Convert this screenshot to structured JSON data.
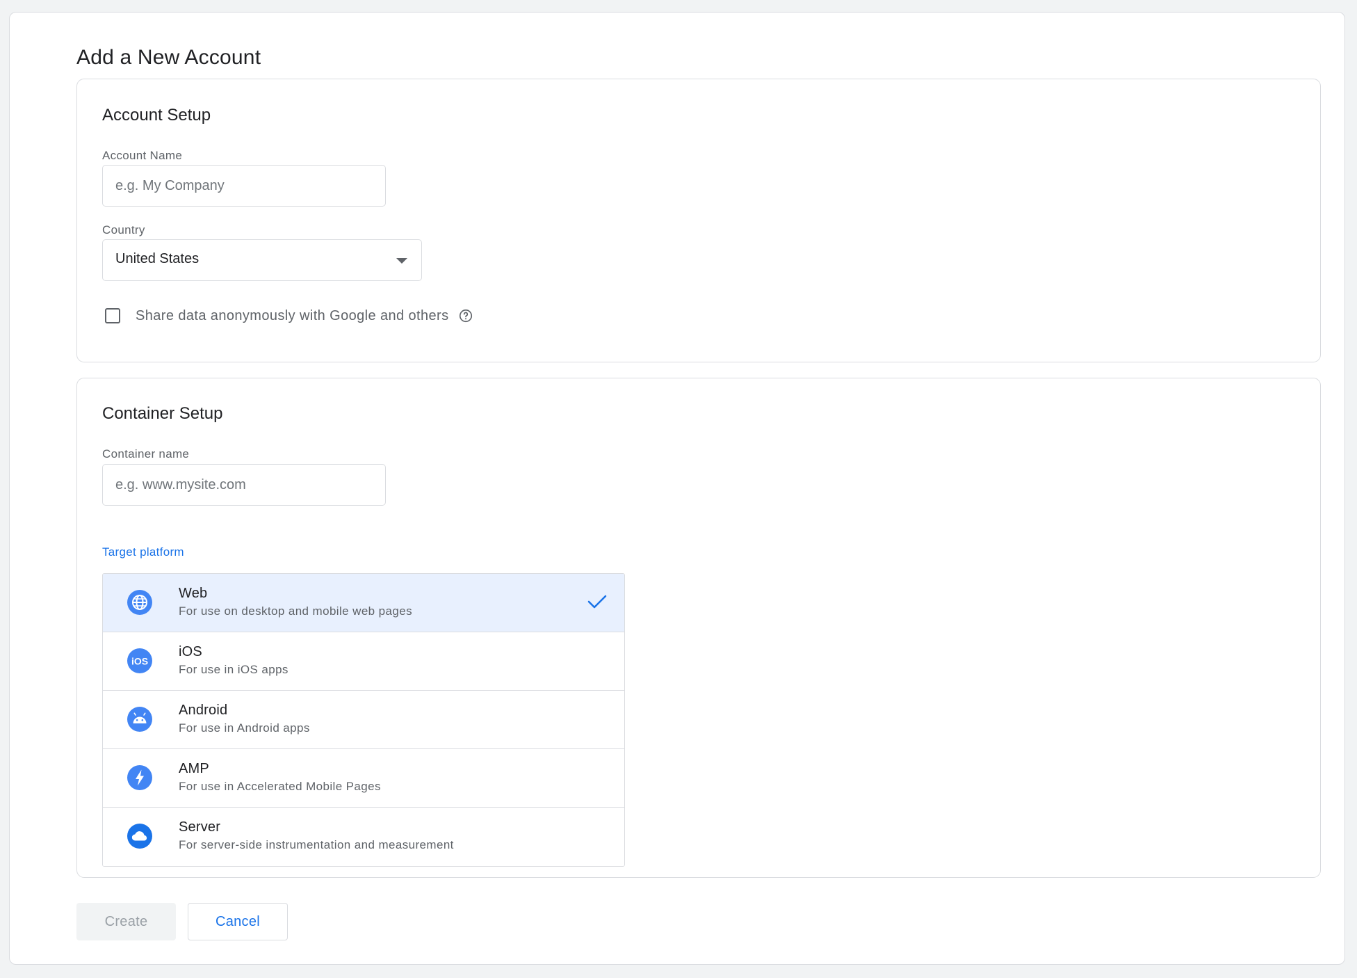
{
  "page": {
    "title": "Add a New Account"
  },
  "account_setup": {
    "title": "Account Setup",
    "account_name": {
      "label": "Account Name",
      "value": "",
      "placeholder": "e.g. My Company"
    },
    "country": {
      "label": "Country",
      "selected": "United States"
    },
    "share_data": {
      "label": "Share data anonymously with Google and others",
      "checked": false,
      "icon": "help-circle-icon"
    }
  },
  "container_setup": {
    "title": "Container Setup",
    "container_name": {
      "label": "Container name",
      "value": "",
      "placeholder": "e.g. www.mysite.com"
    },
    "target_platform": {
      "label": "Target platform",
      "options": [
        {
          "name": "Web",
          "description": "For use on desktop and mobile web pages",
          "icon": "globe-icon",
          "selected": true
        },
        {
          "name": "iOS",
          "description": "For use in iOS apps",
          "icon": "ios-icon",
          "selected": false
        },
        {
          "name": "Android",
          "description": "For use in Android apps",
          "icon": "android-icon",
          "selected": false
        },
        {
          "name": "AMP",
          "description": "For use in Accelerated Mobile Pages",
          "icon": "lightning-icon",
          "selected": false
        },
        {
          "name": "Server",
          "description": "For server-side instrumentation and measurement",
          "icon": "cloud-icon",
          "selected": false
        }
      ]
    }
  },
  "actions": {
    "create_label": "Create",
    "create_enabled": false,
    "cancel_label": "Cancel"
  },
  "colors": {
    "accent": "#1a73e8",
    "icon_blue": "#4285f4",
    "selected_bg": "#e8f0fe",
    "border": "#dadce0",
    "muted_text": "#5f6368"
  }
}
